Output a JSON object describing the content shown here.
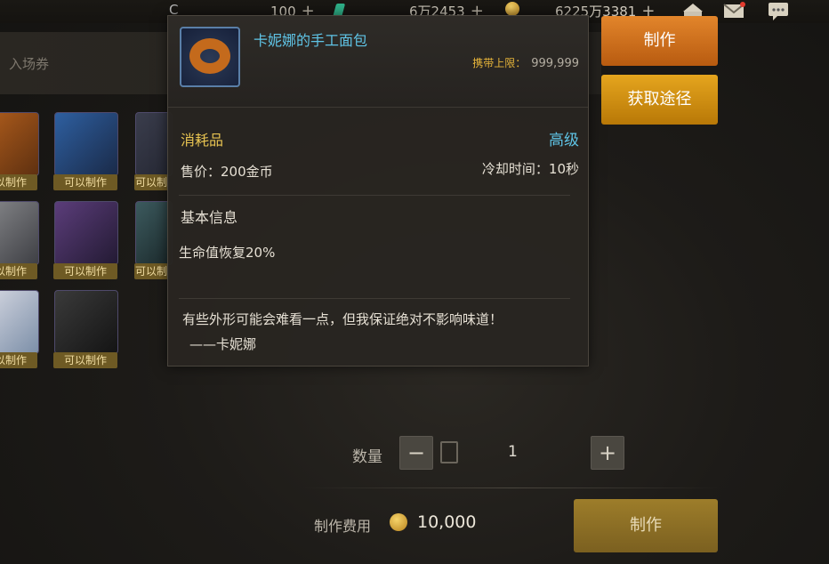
{
  "topbar": {
    "currency_1": "100",
    "currency_2": "6万2453",
    "currency_3": "6225万3381",
    "plus": "+",
    "c_symbol": "C"
  },
  "left": {
    "ticket_label": "入场券",
    "can_craft": "可以制作"
  },
  "item": {
    "name": "卡妮娜的手工面包",
    "carry_limit_label": "携带上限：",
    "carry_limit_value": "999,999",
    "category": "消耗品",
    "grade": "高级",
    "price": "售价：200金币",
    "cooldown": "冷却时间：10秒",
    "basic_info_title": "基本信息",
    "effect": "生命值恢复20%",
    "flavor_line1": "有些外形可能会难看一点，但我保证绝对不影响味道！",
    "flavor_line2": "——卡妮娜",
    "grade_color": "#5fc4e6"
  },
  "actions": {
    "make_label": "制作",
    "source_label": "获取途径"
  },
  "quantity": {
    "label": "数量",
    "minus": "−",
    "plus": "+",
    "value": "1"
  },
  "cost": {
    "label": "制作费用",
    "value": "10,000",
    "make_label": "制作"
  }
}
